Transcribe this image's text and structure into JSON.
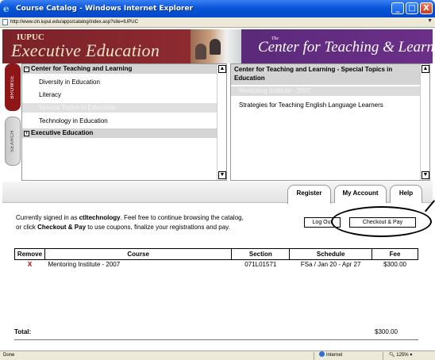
{
  "window": {
    "title": "Course Catalog - Windows Internet Explorer",
    "url": "http://www.cln.iupui.edu/apps/catalog/index.asp?site=IUPUC",
    "buttons": {
      "minimize": "_",
      "maximize": "□",
      "close": "X"
    }
  },
  "banner": {
    "left_small": "IUPUC",
    "left_big": "Executive Education",
    "right_small": "The",
    "right_big": "Center for Teaching & Learning"
  },
  "side_tabs": {
    "browse": "BROWSE",
    "search": "SEARCH"
  },
  "left_panel": {
    "items": [
      {
        "label": "Center for Teaching and Learning",
        "kind": "section",
        "expander": "⊟"
      },
      {
        "label": "Diversity in Education",
        "kind": "child"
      },
      {
        "label": "Literacy",
        "kind": "child"
      },
      {
        "label": "Special Topics in Education",
        "kind": "child",
        "selected": true
      },
      {
        "label": "Technology in Education",
        "kind": "child"
      },
      {
        "label": "Executive Education",
        "kind": "section",
        "expander": "⊞"
      }
    ]
  },
  "right_panel": {
    "heading": "Center for Teaching and Learning - Special Topics in Education",
    "items": [
      {
        "label": "Mentoring Institute - 2007",
        "selected": true
      },
      {
        "label": "Strategies for Teaching English Language Learners"
      }
    ]
  },
  "tabs": {
    "register": "Register",
    "account": "My Account",
    "help": "Help"
  },
  "signin": {
    "prefix": "Currently signed in as ",
    "user": "ctltechnology",
    "suffix": ". Feel free to continue browsing the catalog,",
    "line2_prefix": "or click ",
    "line2_bold": "Checkout & Pay",
    "line2_suffix": " to use coupons, finalize your registrations and pay."
  },
  "buttons": {
    "logout": "Log Out",
    "checkout": "Checkout & Pay"
  },
  "cart": {
    "headers": [
      "Remove",
      "Course",
      "Section",
      "Schedule",
      "Fee"
    ],
    "rows": [
      {
        "remove": "X",
        "course": "Mentoring Institute - 2007",
        "section": "071L01571",
        "schedule": "FSa / Jan 20 - Apr 27",
        "fee": "$300.00"
      }
    ],
    "total_label": "Total:",
    "total_value": "$300.00"
  },
  "status": {
    "left": "Done",
    "zone": "Internet",
    "zoom": "125%"
  },
  "colors": {
    "title_bar": "#0a56d8",
    "exec_banner": "#7b2128",
    "ctl_banner": "#5b2a7a",
    "browse_tab": "#8e1616",
    "remove_x": "#c00000"
  }
}
